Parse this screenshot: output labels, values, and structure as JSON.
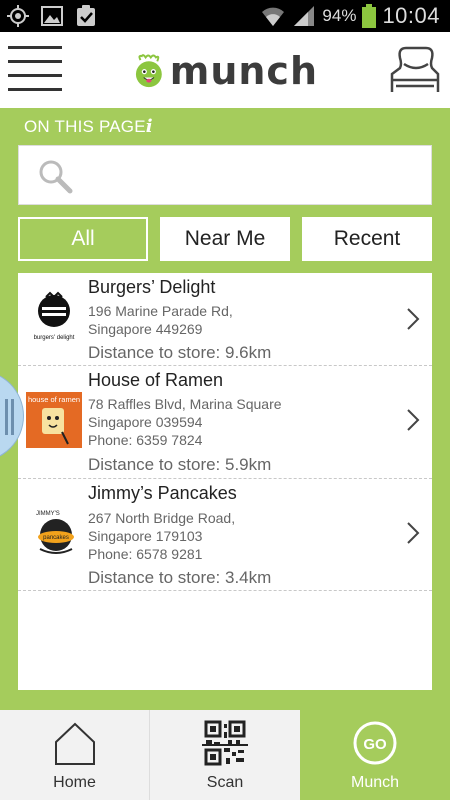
{
  "status_bar": {
    "battery_percent": "94%",
    "time": "10:04",
    "icons": [
      "gps-icon",
      "image-icon",
      "clipboard-check-icon",
      "wifi-icon",
      "signal-icon",
      "battery-icon"
    ]
  },
  "header": {
    "logo_text": "munch",
    "menu_icon": "hamburger-icon",
    "profile_icon": "profiles-icon"
  },
  "section": {
    "title": "ON THIS PAGE",
    "info_glyph": "i"
  },
  "search": {
    "placeholder": "",
    "value": "",
    "icon": "search-icon"
  },
  "tabs": [
    {
      "label": "All",
      "selected": true
    },
    {
      "label": "Near Me",
      "selected": false
    },
    {
      "label": "Recent",
      "selected": false
    }
  ],
  "stores": [
    {
      "name": "Burgers’ Delight",
      "address_lines": [
        "196 Marine Parade Rd,",
        "Singapore 449269"
      ],
      "distance": "Distance to store: 9.6km",
      "logo_caption": "burgers' delight"
    },
    {
      "name": "House of Ramen",
      "address_lines": [
        "78 Raffles Blvd, Marina Square",
        "Singapore 039594",
        "Phone: 6359 7824"
      ],
      "distance": "Distance to store: 5.9km",
      "logo_caption": "house of ramen"
    },
    {
      "name": "Jimmy’s Pancakes",
      "address_lines": [
        "267 North Bridge Road,",
        "Singapore 179103",
        "Phone: 6578 9281"
      ],
      "distance": "Distance to store: 3.4km",
      "logo_caption_top": "JIMMY'S",
      "logo_caption": "pancakes"
    }
  ],
  "bottom_nav": [
    {
      "label": "Home",
      "icon": "home-icon",
      "active": false
    },
    {
      "label": "Scan",
      "icon": "qr-code-icon",
      "active": false
    },
    {
      "label": "Munch",
      "icon": "go-icon",
      "active": true,
      "icon_text": "GO"
    }
  ],
  "colors": {
    "brand_green": "#a5cc5c",
    "accent_lime": "#8cc63f"
  }
}
